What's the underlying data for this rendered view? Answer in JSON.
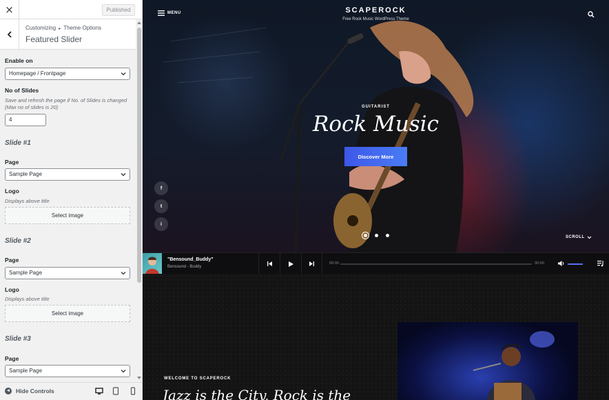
{
  "customizer": {
    "close_label": "×",
    "publish_label": "Published",
    "breadcrumb": {
      "parent": "Customizing",
      "separator": "▸",
      "current": "Theme Options"
    },
    "section_title": "Featured Slider",
    "enable_on": {
      "label": "Enable on",
      "value": "Homepage / Frontpage"
    },
    "no_of_slides": {
      "label": "No of Slides",
      "description": "Save and refresh the page if No. of Slides is changed (Max no of slides is 20)",
      "value": "4"
    },
    "slides": [
      {
        "heading": "Slide #1",
        "page_label": "Page",
        "page_value": "Sample Page",
        "logo_label": "Logo",
        "logo_desc": "Displays above title",
        "select_image_label": "Select image"
      },
      {
        "heading": "Slide #2",
        "page_label": "Page",
        "page_value": "Sample Page",
        "logo_label": "Logo",
        "logo_desc": "Displays above title",
        "select_image_label": "Select image"
      },
      {
        "heading": "Slide #3",
        "page_label": "Page",
        "page_value": "Sample Page"
      }
    ],
    "footer": {
      "hide_controls_label": "Hide Controls",
      "devices": [
        "desktop-icon",
        "tablet-icon",
        "mobile-icon"
      ]
    }
  },
  "preview": {
    "menu_label": "MENU",
    "site_title": "SCAPEROCK",
    "site_tagline": "Free Rock Music WordPress Theme",
    "hero": {
      "subtitle": "GUITARIST",
      "title": "Rock Music",
      "button_label": "Discover More",
      "social": [
        "f",
        "t",
        "i"
      ],
      "slider_dots": 3,
      "active_dot": 1,
      "scroll_label": "SCROLL"
    },
    "player": {
      "track_title": "\"Bensound_Buddy\"",
      "track_artist": "Bensound - Buddy",
      "time_elapsed": "00:00",
      "time_total": "00:00"
    },
    "lower": {
      "eyebrow": "WELCOME TO SCAPEROCK",
      "title": "Jazz is the City, Rock is the"
    },
    "colors": {
      "accent": "#3d57e8",
      "sidebar_bg": "#f1f1f1",
      "player_bg": "#0e0e10"
    }
  }
}
